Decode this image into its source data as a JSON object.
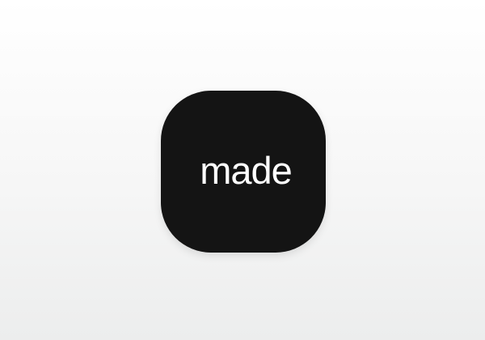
{
  "app_icon": {
    "label": "made",
    "background_color": "#141414",
    "text_color": "#ffffff"
  },
  "page": {
    "background_top": "#ffffff",
    "background_bottom": "#eceded"
  }
}
